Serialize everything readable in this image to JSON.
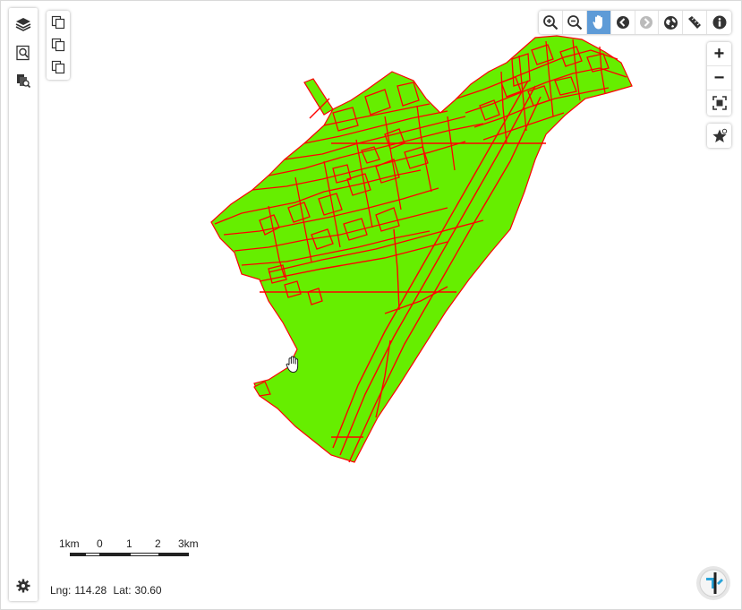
{
  "left_rail": {
    "items": [
      {
        "icon": "layers-icon"
      },
      {
        "icon": "search-map-icon"
      },
      {
        "icon": "query-layer-icon"
      }
    ],
    "bottom_icon": "gear-icon"
  },
  "box_tools": [
    {
      "icon": "copy-layer-icon"
    },
    {
      "icon": "copy-layer-icon"
    },
    {
      "icon": "copy-layer-icon"
    }
  ],
  "toolbar": {
    "buttons": [
      {
        "icon": "zoom-in-icon"
      },
      {
        "icon": "zoom-out-icon"
      },
      {
        "icon": "pan-hand-icon",
        "active": true
      },
      {
        "icon": "back-icon"
      },
      {
        "icon": "forward-icon",
        "disabled": true
      },
      {
        "icon": "globe-icon"
      },
      {
        "icon": "measure-icon"
      },
      {
        "icon": "info-icon"
      }
    ]
  },
  "zoom": {
    "in_label": "+",
    "out_label": "−"
  },
  "scale_bar": {
    "labels": [
      "1km",
      "0",
      "1",
      "2",
      "3km"
    ]
  },
  "coords": {
    "lng_label": "Lng:",
    "lng_value": "114.28",
    "lat_label": "Lat:",
    "lat_value": "30.60"
  },
  "map": {
    "fill_color": "#66ee00",
    "stroke_color": "#ff0000"
  }
}
